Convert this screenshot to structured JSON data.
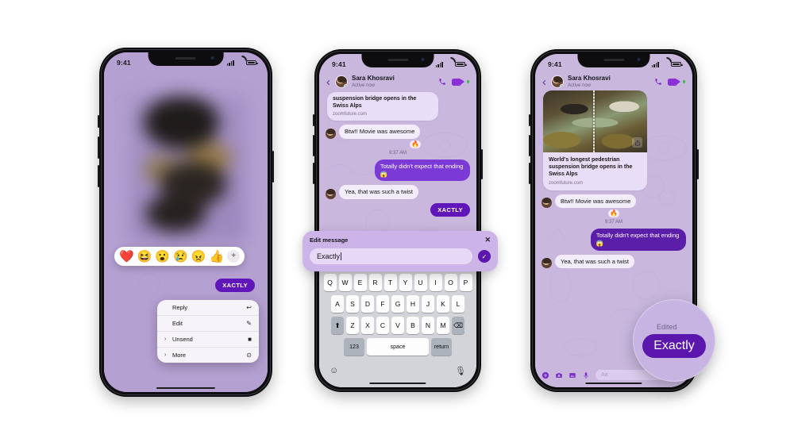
{
  "status_bar": {
    "time": "9:41"
  },
  "chat": {
    "contact_name": "Sara Khosravi",
    "presence": "Active now",
    "timestamp": "9:37 AM",
    "link_preview": {
      "title": "World's longest pedestrian suspension bridge opens in the Swiss Alps",
      "title_partial": "suspension bridge opens in the Swiss Alps",
      "domain": "zoomfuture.com"
    },
    "messages": {
      "incoming_1": "Btw!! Movie was awesome",
      "reaction_1": "🔥",
      "outgoing_1": "Totally didn't expect that ending 😱",
      "incoming_2": "Yea, that was such a twist",
      "outgoing_2": "XACTLY"
    },
    "composer": {
      "placeholder": "Aa",
      "icons": [
        "plus-icon",
        "camera-icon",
        "gallery-icon",
        "microphone-icon",
        "thumbs-up-icon"
      ]
    }
  },
  "reaction_bar": {
    "emojis": [
      "❤️",
      "😆",
      "😮",
      "😢",
      "😠",
      "👍"
    ],
    "more_label": "+"
  },
  "context_menu": {
    "items": [
      {
        "label": "Reply",
        "icon": "reply-arrow-icon",
        "glyph": "↩",
        "submenu": false
      },
      {
        "label": "Edit",
        "icon": "pencil-icon",
        "glyph": "✎",
        "submenu": false
      },
      {
        "label": "Unsend",
        "icon": "trash-icon",
        "glyph": "🗑",
        "submenu": true
      },
      {
        "label": "More",
        "icon": "info-circle-icon",
        "glyph": "⊙",
        "submenu": true
      }
    ]
  },
  "edit_panel": {
    "title": "Edit message",
    "close_label": "✕",
    "input_value": "Exactly",
    "confirm_label": "✓"
  },
  "keyboard": {
    "row1": [
      "Q",
      "W",
      "E",
      "R",
      "T",
      "Y",
      "U",
      "I",
      "O",
      "P"
    ],
    "row2": [
      "A",
      "S",
      "D",
      "F",
      "G",
      "H",
      "J",
      "K",
      "L"
    ],
    "row3": [
      "Z",
      "X",
      "C",
      "V",
      "B",
      "N",
      "M"
    ],
    "shift": "⬆",
    "backspace": "⌫",
    "numbers": "123",
    "space": "space",
    "return": "return",
    "emoji_key": "☺",
    "mic_key": "🎙"
  },
  "magnifier": {
    "edited_label": "Edited",
    "bubble_text": "Exactly"
  },
  "colors": {
    "brand_purple": "#7b3ad6",
    "deep_purple": "#5b17ad",
    "chat_bg": "#c6b3dd",
    "bubble_in": "#f3edfb",
    "page_bg": "#ffffff"
  }
}
